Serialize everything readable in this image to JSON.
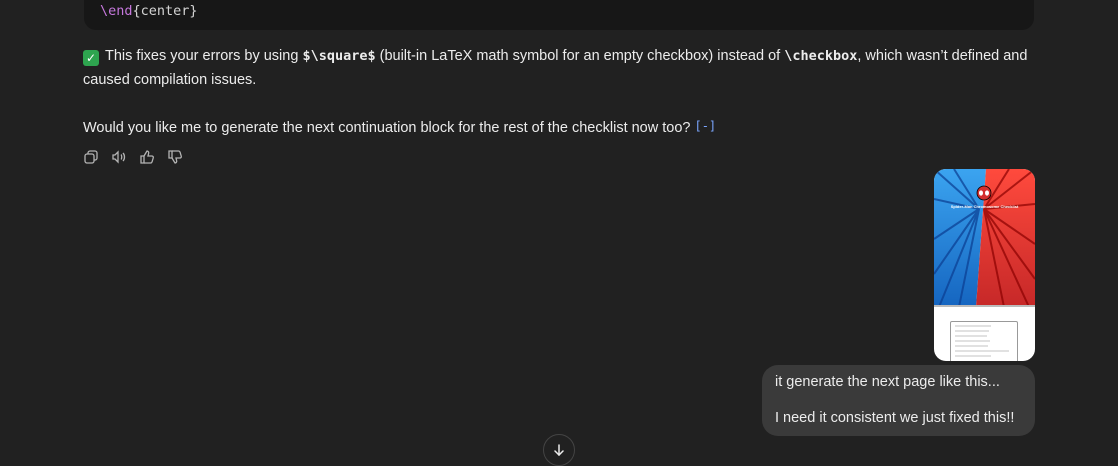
{
  "code": {
    "keyword": "\\end",
    "argument": "{center}"
  },
  "assistant": {
    "check_icon": "✓",
    "fix_pre": "This fixes your errors by using ",
    "fix_code1": "$\\square$",
    "fix_mid": " (built-in LaTeX math symbol for an empty checkbox) instead of ",
    "fix_code2": "\\checkbox",
    "fix_post": ", which wasn’t defined and caused compilation issues.",
    "question": "Would you like me to generate the next continuation block for the rest of the checklist now too?",
    "cite_glyph": "[-]"
  },
  "attachment": {
    "title": "Spider-Man Chromosome Checklist",
    "colors": {
      "blue": "#1e88e5",
      "red": "#e53935"
    }
  },
  "user": {
    "line1": "it generate the next page like this...",
    "line2": "I need it consistent we just fixed this!!"
  }
}
